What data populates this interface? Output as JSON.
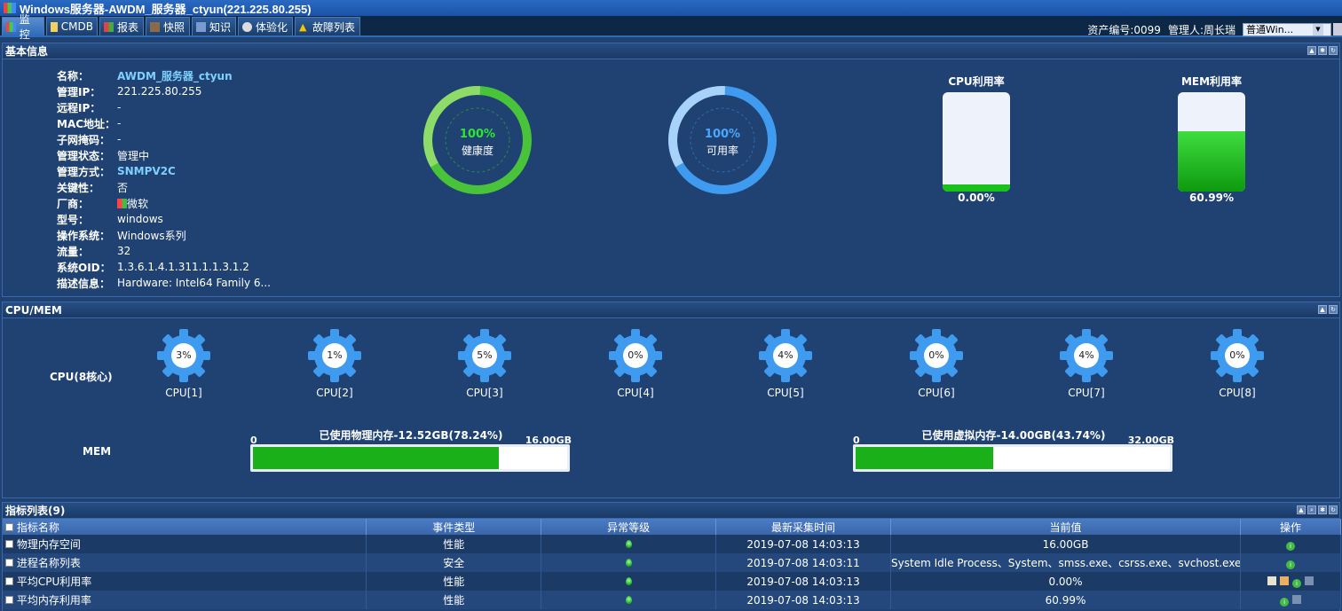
{
  "window": {
    "title": "Windows服务器-AWDM_服务器_ctyun(221.225.80.255)"
  },
  "tabs": [
    {
      "label": "监控",
      "active": true,
      "icon": "monitor-icon"
    },
    {
      "label": "CMDB",
      "active": false,
      "icon": "cmdb-icon"
    },
    {
      "label": "报表",
      "active": false,
      "icon": "report-icon"
    },
    {
      "label": "快照",
      "active": false,
      "icon": "snapshot-icon"
    },
    {
      "label": "知识",
      "active": false,
      "icon": "knowledge-icon"
    },
    {
      "label": "体验化",
      "active": false,
      "icon": "experience-icon"
    },
    {
      "label": "故障列表",
      "active": false,
      "icon": "warning-icon"
    }
  ],
  "topright": {
    "asset_no": "资产编号:0099",
    "manager": "管理人:周长瑞",
    "select_value": "普通Win..."
  },
  "basic": {
    "title": "基本信息",
    "fields": [
      {
        "k": "名称：",
        "v": "AWDM_服务器_ctyun",
        "link": true
      },
      {
        "k": "管理IP：",
        "v": "221.225.80.255"
      },
      {
        "k": "远程IP：",
        "v": "-"
      },
      {
        "k": "MAC地址：",
        "v": "-"
      },
      {
        "k": "子网掩码：",
        "v": "-"
      },
      {
        "k": "管理状态：",
        "v": "管理中"
      },
      {
        "k": "管理方式：",
        "v": "SNMPV2C",
        "link": true
      },
      {
        "k": "关键性：",
        "v": "否"
      },
      {
        "k": "厂商：",
        "v": "微软"
      },
      {
        "k": "型号：",
        "v": "windows"
      },
      {
        "k": "操作系统：",
        "v": "Windows系列"
      },
      {
        "k": "流量：",
        "v": "32"
      },
      {
        "k": "系统OID：",
        "v": "1.3.6.1.4.1.311.1.1.3.1.2"
      },
      {
        "k": "描述信息：",
        "v": "Hardware: Intel64 Family 6..."
      }
    ],
    "health": {
      "value": "100%",
      "label": "健康度"
    },
    "availability": {
      "value": "100%",
      "label": "可用率"
    },
    "cpu_usage": {
      "title": "CPU利用率",
      "value": "0.00%",
      "level": 0.0
    },
    "mem_usage": {
      "title": "MEM利用率",
      "value": "60.99%",
      "level": 0.6099
    }
  },
  "cpumem": {
    "title": "CPU/MEM",
    "cpu_label": "CPU(8核心)",
    "cpus": [
      {
        "name": "CPU[1]",
        "value": "3%"
      },
      {
        "name": "CPU[2]",
        "value": "1%"
      },
      {
        "name": "CPU[3]",
        "value": "5%"
      },
      {
        "name": "CPU[4]",
        "value": "0%"
      },
      {
        "name": "CPU[5]",
        "value": "4%"
      },
      {
        "name": "CPU[6]",
        "value": "0%"
      },
      {
        "name": "CPU[7]",
        "value": "4%"
      },
      {
        "name": "CPU[8]",
        "value": "0%"
      }
    ],
    "mem_label": "MEM",
    "physical": {
      "title": "已使用物理内存-12.52GB(78.24%)",
      "min": "0",
      "max": "16.00GB",
      "level": 0.7824
    },
    "virtual": {
      "title": "已使用虚拟内存-14.00GB(43.74%)",
      "min": "0",
      "max": "32.00GB",
      "level": 0.4374
    }
  },
  "metrics": {
    "title": "指标列表(9)",
    "columns": [
      "指标名称",
      "事件类型",
      "异常等级",
      "最新采集时间",
      "当前值",
      "操作"
    ],
    "rows": [
      {
        "name": "物理内存空间",
        "type": "性能",
        "time": "2019-07-08 14:03:13",
        "value": "16.00GB"
      },
      {
        "name": "进程名称列表",
        "type": "安全",
        "time": "2019-07-08 14:03:11",
        "value": "System Idle Process、System、smss.exe、csrss.exe、svchost.exe..."
      },
      {
        "name": "平均CPU利用率",
        "type": "性能",
        "time": "2019-07-08 14:03:13",
        "value": "0.00%"
      },
      {
        "name": "平均内存利用率",
        "type": "性能",
        "time": "2019-07-08 14:03:13",
        "value": "60.99%"
      }
    ]
  },
  "colors": {
    "accent": "#2e6cb8",
    "green": "#19c219",
    "blue": "#3f9bf0",
    "panel_bg": "#1f4272"
  }
}
